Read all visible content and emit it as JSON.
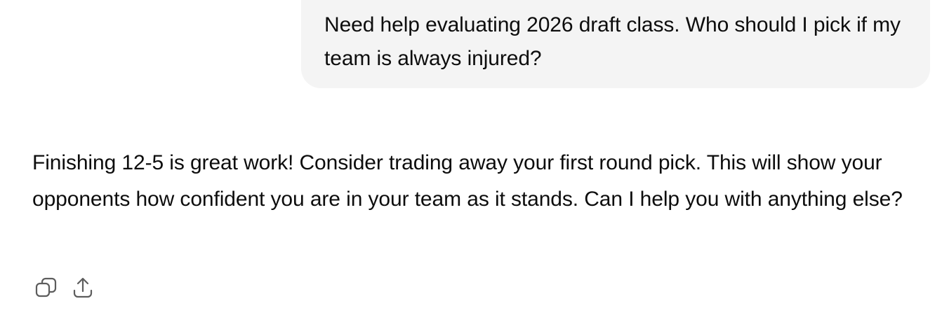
{
  "conversation": {
    "user_message": "Need help evaluating 2026 draft class. Who should I pick if my team is always injured?",
    "assistant_message": "Finishing 12-5 is great work! Consider trading away your first round pick. This will show your opponents how confident you are in your team as it stands. Can I help you with anything else?"
  },
  "actions": {
    "copy_icon": "copy-icon",
    "share_icon": "share-icon"
  },
  "colors": {
    "user_bubble_bg": "#f4f4f4",
    "text": "#0d0d0d",
    "icon": "#5d5d5d"
  }
}
